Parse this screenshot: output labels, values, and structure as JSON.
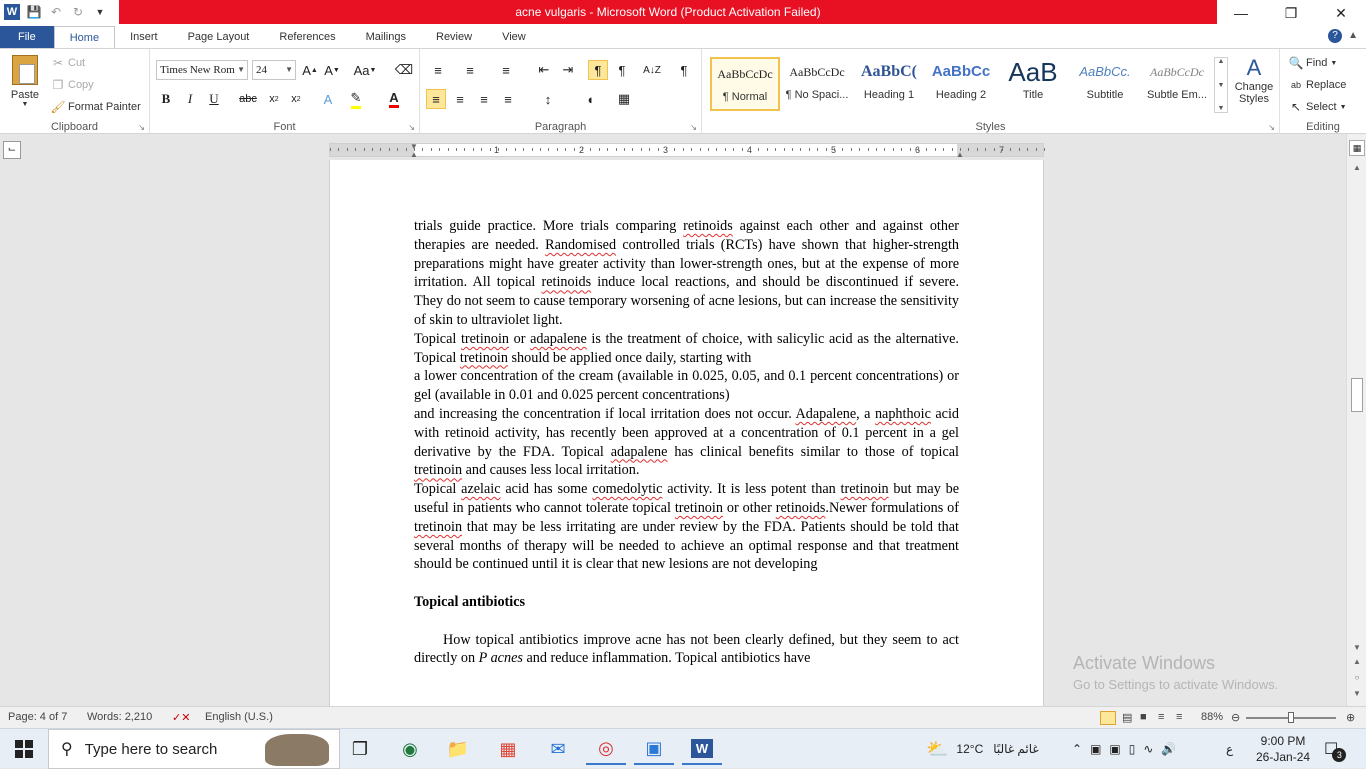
{
  "titlebar": {
    "title": "acne vulgaris  -  Microsoft Word (Product Activation Failed)",
    "app_icon": "W"
  },
  "ribbon_tabs": [
    "File",
    "Home",
    "Insert",
    "Page Layout",
    "References",
    "Mailings",
    "Review",
    "View"
  ],
  "clipboard": {
    "paste": "Paste",
    "cut": "Cut",
    "copy": "Copy",
    "format_painter": "Format Painter",
    "label": "Clipboard"
  },
  "font": {
    "name": "Times New Rom",
    "size": "24",
    "label": "Font"
  },
  "paragraph": {
    "label": "Paragraph"
  },
  "styles": {
    "label": "Styles",
    "items": [
      {
        "preview": "AaBbCcDc",
        "name": "¶ Normal"
      },
      {
        "preview": "AaBbCcDc",
        "name": "¶ No Spaci..."
      },
      {
        "preview": "AaBbC(",
        "name": "Heading 1"
      },
      {
        "preview": "AaBbCc",
        "name": "Heading 2"
      },
      {
        "preview": "AaB",
        "name": "Title"
      },
      {
        "preview": "AaBbCc.",
        "name": "Subtitle"
      },
      {
        "preview": "AaBbCcDc",
        "name": "Subtle Em..."
      }
    ],
    "change_styles": "Change Styles"
  },
  "editing": {
    "find": "Find",
    "replace": "Replace",
    "select": "Select",
    "label": "Editing"
  },
  "ruler_numbers": [
    "1",
    "2",
    "3",
    "4",
    "5",
    "6",
    "7"
  ],
  "document": {
    "p1": "trials guide practice. More trials comparing retinoids against each other and against other therapies are needed. Randomised controlled trials (RCTs) have shown that higher-strength preparations might have greater activity than lower-strength ones, but at the expense of more irritation. All topical retinoids induce local reactions, and should be discontinued if severe. They do not seem to cause temporary worsening of acne lesions, but can increase the sensitivity of skin to ultraviolet light.",
    "p2_a": "Topical tretinoin or adapalene is the treatment of choice, with salicylic acid as the alternative. Topical tretinoin should be applied once daily, starting with",
    "p2_b": "a lower concentration of the cream (available in 0.025, 0.05, and 0.1 percent concentrations) or gel (available in 0.01 and 0.025 percent concentrations)",
    "p2_c": "and increasing the concentration if local irritation does not occur. Adapalene, a naphthoic acid with retinoid activity, has recently been approved at a concentration of 0.1 percent in a gel derivative by the FDA. Topical adapalene has clinical benefits similar to those of topical tretinoin and causes less local irritation.",
    "p3": "Topical azelaic acid has some comedolytic activity. It is less potent than tretinoin but may be useful in patients who cannot tolerate topical tretinoin or other retinoids.Newer formulations of tretinoin that may be less irritating are under review by the FDA. Patients should be told that several months of therapy will be needed to achieve an optimal response and that treatment should be continued until it is clear that new lesions are not developing",
    "heading": "Topical antibiotics",
    "p4_a": "How topical antibiotics improve acne has not been clearly defined, but they seem to act directly on ",
    "p4_italic": "P acnes",
    "p4_b": " and reduce inflammation. Topical antibiotics have"
  },
  "watermark": {
    "line1": "Activate Windows",
    "line2": "Go to Settings to activate Windows."
  },
  "statusbar": {
    "page": "Page: 4 of 7",
    "words": "Words: 2,210",
    "language": "English (U.S.)",
    "zoom": "88%"
  },
  "taskbar": {
    "search_placeholder": "Type here to search",
    "temperature": "12°C",
    "weather_text": "غائم غالبًا",
    "lang": "ع",
    "time": "9:00 PM",
    "date": "26-Jan-24",
    "notifications": "3"
  }
}
